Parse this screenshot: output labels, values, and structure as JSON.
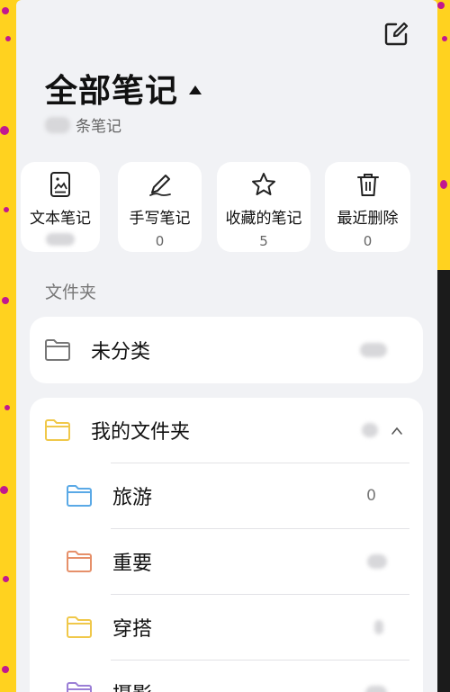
{
  "header": {
    "title": "全部笔记",
    "note_count_suffix": "条笔记"
  },
  "categories": [
    {
      "label": "文本笔记",
      "count": "",
      "icon": "document-icon"
    },
    {
      "label": "手写笔记",
      "count": "0",
      "icon": "pen-icon"
    },
    {
      "label": "收藏的笔记",
      "count": "5",
      "icon": "star-icon"
    },
    {
      "label": "最近删除",
      "count": "0",
      "icon": "trash-icon"
    }
  ],
  "folders_section": {
    "label": "文件夹",
    "unclassified": {
      "name": "未分类",
      "count": ""
    },
    "my_folders": {
      "name": "我的文件夹",
      "count": "",
      "children": [
        {
          "name": "旅游",
          "count": "0",
          "color": "#5aa9e6"
        },
        {
          "name": "重要",
          "count": "",
          "color": "#e6906a"
        },
        {
          "name": "穿搭",
          "count": "",
          "color": "#f0c84a"
        },
        {
          "name": "摄影",
          "count": "",
          "color": "#9b7fd6"
        }
      ]
    }
  },
  "colors": {
    "background_accent": "#ffd21f",
    "panel": "#f1f2f5",
    "folder_default": "#777777",
    "folder_mine": "#f0c84a"
  }
}
